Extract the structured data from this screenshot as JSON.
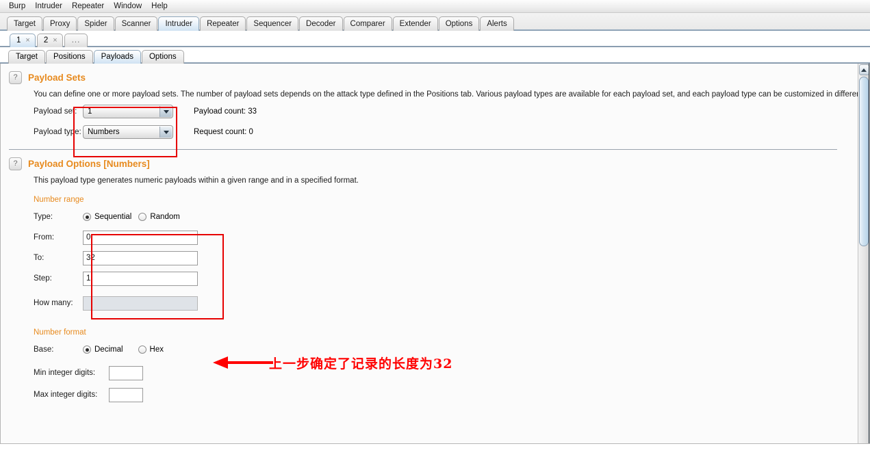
{
  "menu": {
    "items": [
      {
        "label": "Burp"
      },
      {
        "label": "Intruder"
      },
      {
        "label": "Repeater"
      },
      {
        "label": "Window"
      },
      {
        "label": "Help"
      }
    ]
  },
  "main_tabs": {
    "selected": "Intruder",
    "items": [
      {
        "label": "Target"
      },
      {
        "label": "Proxy"
      },
      {
        "label": "Spider"
      },
      {
        "label": "Scanner"
      },
      {
        "label": "Intruder"
      },
      {
        "label": "Repeater"
      },
      {
        "label": "Sequencer"
      },
      {
        "label": "Decoder"
      },
      {
        "label": "Comparer"
      },
      {
        "label": "Extender"
      },
      {
        "label": "Options"
      },
      {
        "label": "Alerts"
      }
    ]
  },
  "attack_tabs": {
    "selected": "1",
    "close_glyph": "×",
    "items": [
      {
        "label": "1"
      },
      {
        "label": "2"
      }
    ],
    "more_label": "..."
  },
  "sub_tabs": {
    "selected": "Payloads",
    "items": [
      {
        "label": "Target"
      },
      {
        "label": "Positions"
      },
      {
        "label": "Payloads"
      },
      {
        "label": "Options"
      }
    ]
  },
  "payload_sets": {
    "help_glyph": "?",
    "title": "Payload Sets",
    "description": "You can define one or more payload sets. The number of payload sets depends on the attack type defined in the Positions tab. Various payload types are available for each payload set, and each payload type can be customized in different ways.",
    "payload_set_label": "Payload set:",
    "payload_set_value": "1",
    "payload_type_label": "Payload type:",
    "payload_type_value": "Numbers",
    "payload_count_label": "Payload count:  33",
    "request_count_label": "Request count:  0"
  },
  "payload_options": {
    "help_glyph": "?",
    "title": "Payload Options [Numbers]",
    "description": "This payload type generates numeric payloads within a given range and in a specified format.",
    "number_range_heading": "Number range",
    "type_label": "Type:",
    "type_sequential": "Sequential",
    "type_random": "Random",
    "type_selected": "Sequential",
    "from_label": "From:",
    "from_value": "0",
    "to_label": "To:",
    "to_value": "32",
    "step_label": "Step:",
    "step_value": "1",
    "how_many_label": "How many:",
    "how_many_value": "",
    "number_format_heading": "Number format",
    "base_label": "Base:",
    "base_decimal": "Decimal",
    "base_hex": "Hex",
    "base_selected": "Decimal",
    "min_digits_label": "Min integer digits:",
    "min_digits_value": "",
    "max_digits_label": "Max integer digits:",
    "max_digits_value": ""
  },
  "annotation": {
    "text": "上一步确定了记录的长度为32",
    "color": "#ff0000"
  },
  "colors": {
    "section_title": "#e78a1e",
    "annotation_red": "#e60000",
    "tab_selected": "#cfe2f2"
  }
}
